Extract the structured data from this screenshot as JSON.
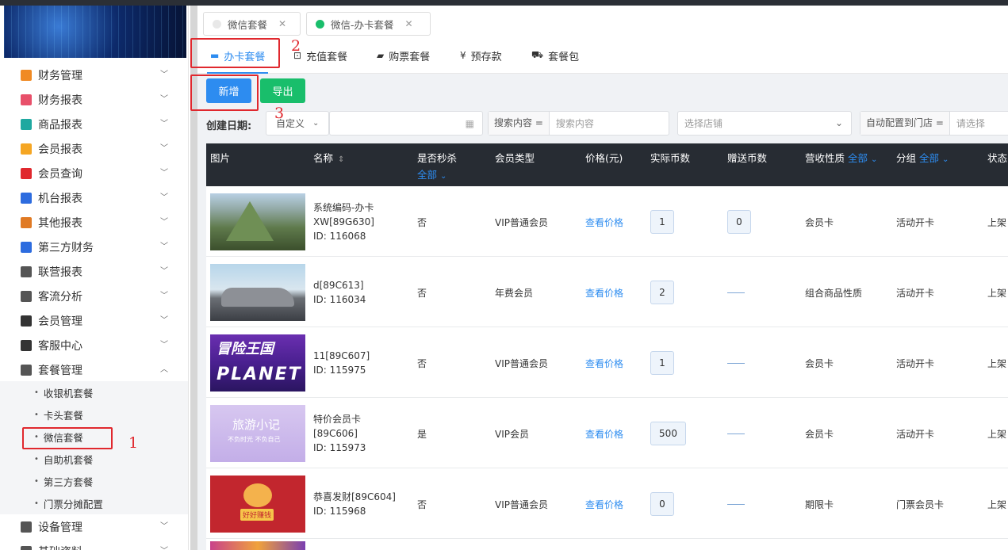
{
  "sidebar": {
    "items": [
      {
        "label": "财务管理",
        "icon": "finance-icon",
        "color": "#f08a24"
      },
      {
        "label": "财务报表",
        "icon": "finance-report-icon",
        "color": "#e8506a"
      },
      {
        "label": "商品报表",
        "icon": "goods-report-icon",
        "color": "#1fa8a0"
      },
      {
        "label": "会员报表",
        "icon": "member-report-icon",
        "color": "#f5a623"
      },
      {
        "label": "会员查询",
        "icon": "member-query-icon",
        "color": "#e0282e"
      },
      {
        "label": "机台报表",
        "icon": "machine-report-icon",
        "color": "#2d6cdf"
      },
      {
        "label": "其他报表",
        "icon": "layers-icon",
        "color": "#e07a24"
      },
      {
        "label": "第三方财务",
        "icon": "calculator-icon",
        "color": "#2d6cdf"
      },
      {
        "label": "联营报表",
        "icon": "users-icon",
        "color": "#555555"
      },
      {
        "label": "客流分析",
        "icon": "target-icon",
        "color": "#555555"
      },
      {
        "label": "会员管理",
        "icon": "user-circle-icon",
        "color": "#333333"
      },
      {
        "label": "客服中心",
        "icon": "headset-icon",
        "color": "#333333"
      },
      {
        "label": "套餐管理",
        "icon": "package-icon",
        "color": "#555555"
      }
    ],
    "sub_items": [
      {
        "label": "收银机套餐"
      },
      {
        "label": "卡头套餐"
      },
      {
        "label": "微信套餐"
      },
      {
        "label": "自助机套餐"
      },
      {
        "label": "第三方套餐"
      },
      {
        "label": "门票分摊配置"
      }
    ],
    "after_items": [
      {
        "label": "设备管理",
        "icon": "device-icon"
      },
      {
        "label": "基础资料",
        "icon": "base-data-icon"
      }
    ]
  },
  "annotations": {
    "one": "1",
    "two": "2",
    "three": "3"
  },
  "page_tabs": [
    {
      "label": "微信套餐",
      "status_color": "#e8e8e8"
    },
    {
      "label": "微信-办卡套餐",
      "status_color": "#19be6b"
    }
  ],
  "category_tabs": [
    {
      "label": "办卡套餐",
      "icon": "card-icon"
    },
    {
      "label": "充值套餐",
      "icon": "recharge-icon"
    },
    {
      "label": "购票套餐",
      "icon": "ticket-icon"
    },
    {
      "label": "预存款",
      "icon": "yen-icon"
    },
    {
      "label": "套餐包",
      "icon": "basket-icon"
    }
  ],
  "buttons": {
    "add": "新增",
    "export": "导出"
  },
  "filters": {
    "date_label": "创建日期:",
    "date_mode": "自定义",
    "search_prefix": "搜索内容 =",
    "search_placeholder": "搜索内容",
    "store_placeholder": "选择店铺",
    "auto_prefix": "自动配置到门店 =",
    "auto_placeholder": "请选择"
  },
  "table": {
    "headers": {
      "image": "图片",
      "name": "名称",
      "seckill": "是否秒杀",
      "seckill_filter": "全部",
      "member_type": "会员类型",
      "price": "价格(元)",
      "coins": "实际币数",
      "gift": "赠送币数",
      "revenue": "营收性质",
      "revenue_filter": "全部",
      "group": "分组",
      "group_filter": "全部",
      "status": "状态"
    },
    "rows": [
      {
        "name1": "系统编码-办卡",
        "name2": "XW[89G630]",
        "id": "ID: 116068",
        "seckill": "否",
        "member_type": "VIP普通会员",
        "price": "查看价格",
        "coins": "1",
        "gift": "0",
        "revenue": "会员卡",
        "group": "活动开卡",
        "status": "上架",
        "thumb": "mountain"
      },
      {
        "name1": "d[89C613]",
        "name2": "",
        "id": "ID: 116034",
        "seckill": "否",
        "member_type": "年费会员",
        "price": "查看价格",
        "coins": "2",
        "gift": "",
        "revenue": "组合商品性质",
        "group": "活动开卡",
        "status": "上架",
        "thumb": "car"
      },
      {
        "name1": "11[89C607]",
        "name2": "",
        "id": "ID: 115975",
        "seckill": "否",
        "member_type": "VIP普通会员",
        "price": "查看价格",
        "coins": "1",
        "gift": "",
        "revenue": "会员卡",
        "group": "活动开卡",
        "status": "上架",
        "thumb": "planet"
      },
      {
        "name1": "特价会员卡",
        "name2": "[89C606]",
        "id": "ID: 115973",
        "seckill": "是",
        "member_type": "VIP会员",
        "price": "查看价格",
        "coins": "500",
        "gift": "",
        "revenue": "会员卡",
        "group": "活动开卡",
        "status": "上架",
        "thumb": "travel"
      },
      {
        "name1": "恭喜发财[89C604]",
        "name2": "",
        "id": "ID: 115968",
        "seckill": "否",
        "member_type": "VIP普通会员",
        "price": "查看价格",
        "coins": "0",
        "gift": "",
        "revenue": "期限卡",
        "group": "门票会员卡",
        "status": "上架",
        "thumb": "tiger"
      }
    ]
  },
  "thumb_text": {
    "planet_top": "冒险王国",
    "planet_bottom": "PLANET",
    "travel": "旅游小记",
    "travel_sub": "不负时光 不负自己",
    "tiger": "好好赚钱"
  }
}
